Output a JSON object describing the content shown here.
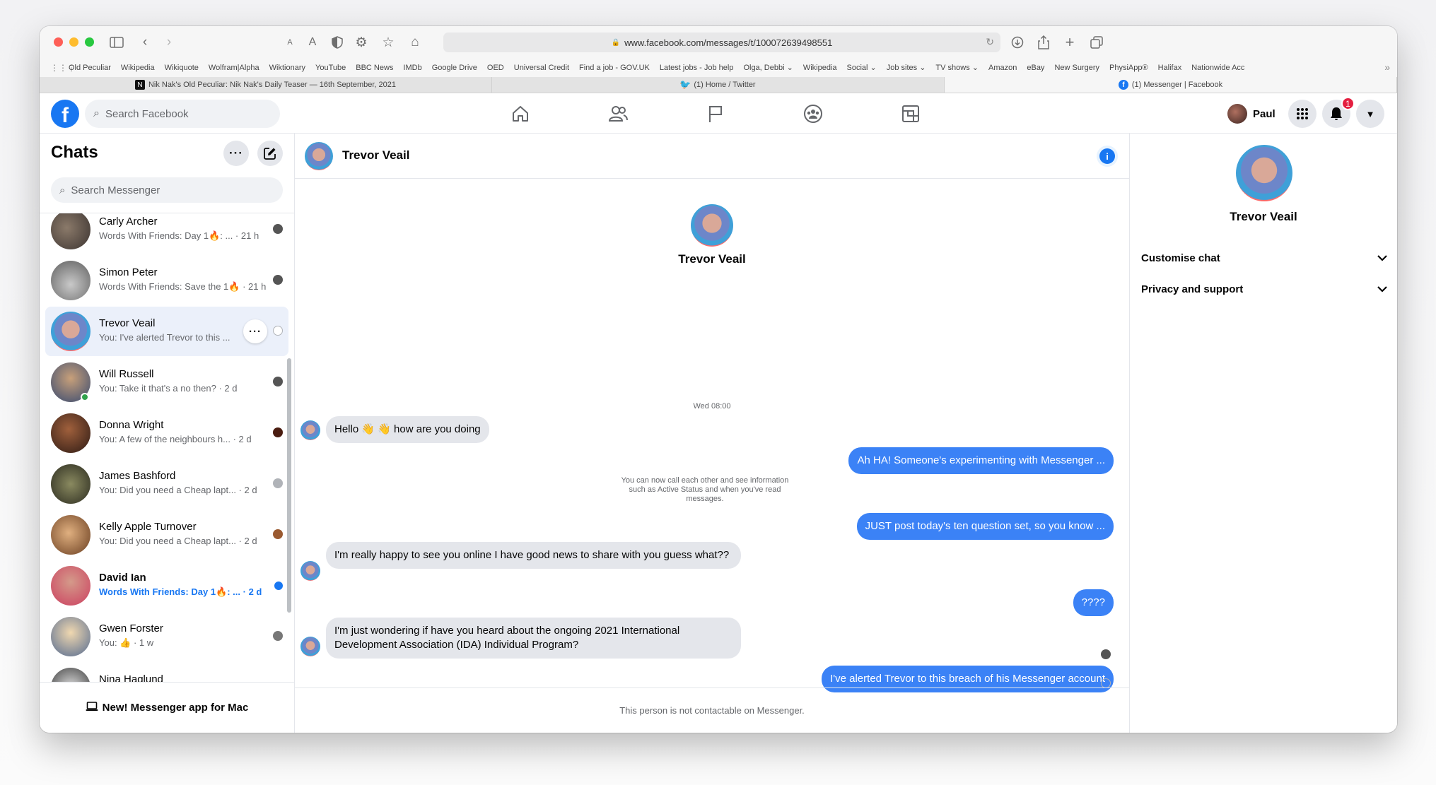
{
  "browser": {
    "url": "www.facebook.com/messages/t/100072639498551",
    "bookmarks": [
      "Old Peculiar",
      "Wikipedia",
      "Wikiquote",
      "Wolfram|Alpha",
      "Wiktionary",
      "YouTube",
      "BBC News",
      "IMDb",
      "Google Drive",
      "OED",
      "Universal Credit",
      "Find a job - GOV.UK",
      "Latest jobs - Job help",
      "Olga, Debbi ⌄",
      "Wikipedia",
      "Social ⌄",
      "Job sites ⌄",
      "TV shows ⌄",
      "Amazon",
      "eBay",
      "New Surgery",
      "PhysiApp®",
      "Halifax",
      "Nationwide Acc"
    ],
    "tabs": [
      {
        "label": "Nik Nak's Old Peculiar: Nik Nak's Daily Teaser — 16th September, 2021",
        "favicon": "N"
      },
      {
        "label": "(1) Home / Twitter",
        "favicon": "🐦"
      },
      {
        "label": "(1) Messenger | Facebook",
        "favicon": "f"
      }
    ]
  },
  "header": {
    "logo": "f",
    "search_placeholder": "Search Facebook",
    "nav_icons": [
      "home-icon",
      "friends-icon",
      "pages-flag-icon",
      "groups-icon",
      "gaming-icon"
    ],
    "user_name": "Paul",
    "notification_count": "1"
  },
  "left": {
    "title": "Chats",
    "search_placeholder": "Search Messenger",
    "chats": [
      {
        "name": "Carly Archer",
        "preview": "Words With Friends: Day 1🔥: ... · 21 h"
      },
      {
        "name": "Simon Peter",
        "preview": "Words With Friends: Save the 1🔥 · 21 h"
      },
      {
        "name": "Trevor Veail",
        "preview": "You: I've alerted Trevor to this ..."
      },
      {
        "name": "Will Russell",
        "preview": "You: Take it that's a no then? · 2 d"
      },
      {
        "name": "Donna Wright",
        "preview": "You: A few of the neighbours h... · 2 d"
      },
      {
        "name": "James Bashford",
        "preview": "You: Did you need a Cheap lapt... · 2 d"
      },
      {
        "name": "Kelly Apple Turnover",
        "preview": "You: Did you need a Cheap lapt... · 2 d"
      },
      {
        "name": "David Ian",
        "preview": "Words With Friends: Day 1🔥: ... · 2 d"
      },
      {
        "name": "Gwen Forster",
        "preview": "You: 👍 · 1 w"
      },
      {
        "name": "Nina Haglund",
        "preview": ""
      }
    ],
    "more_button": "···",
    "new_app_label": "New! Messenger app for Mac"
  },
  "conversation": {
    "contact_name": "Trevor Veail",
    "info_icon": "i",
    "timestamp": "Wed 08:00",
    "system_note": "You can now call each other and see information such as Active Status and when you've read messages.",
    "messages": [
      {
        "from": "them",
        "text": "Hello 👋 👋 how are you doing"
      },
      {
        "from": "me",
        "text": "Ah HA! Someone's experimenting with Messenger ..."
      },
      {
        "from": "me",
        "text": "JUST post today's ten question set, so you know ..."
      },
      {
        "from": "them",
        "text": "I'm really happy to see you online I have good news to share with you guess what??"
      },
      {
        "from": "me",
        "text": "????"
      },
      {
        "from": "them",
        "text": "I'm just wondering if have you heard about the ongoing 2021 International Development Association (IDA) Individual Program?"
      },
      {
        "from": "me",
        "text": "I've alerted Trevor to this breach of his Messenger account"
      }
    ],
    "footer_note": "This person is not contactable on Messenger."
  },
  "right": {
    "name": "Trevor Veail",
    "sections": [
      "Customise chat",
      "Privacy and support"
    ]
  },
  "colors": {
    "accent": "#1877f2",
    "outgoing_bubble": "#3b82f6",
    "incoming_bubble": "#e4e6eb",
    "active_chat": "#ebf0fa"
  }
}
